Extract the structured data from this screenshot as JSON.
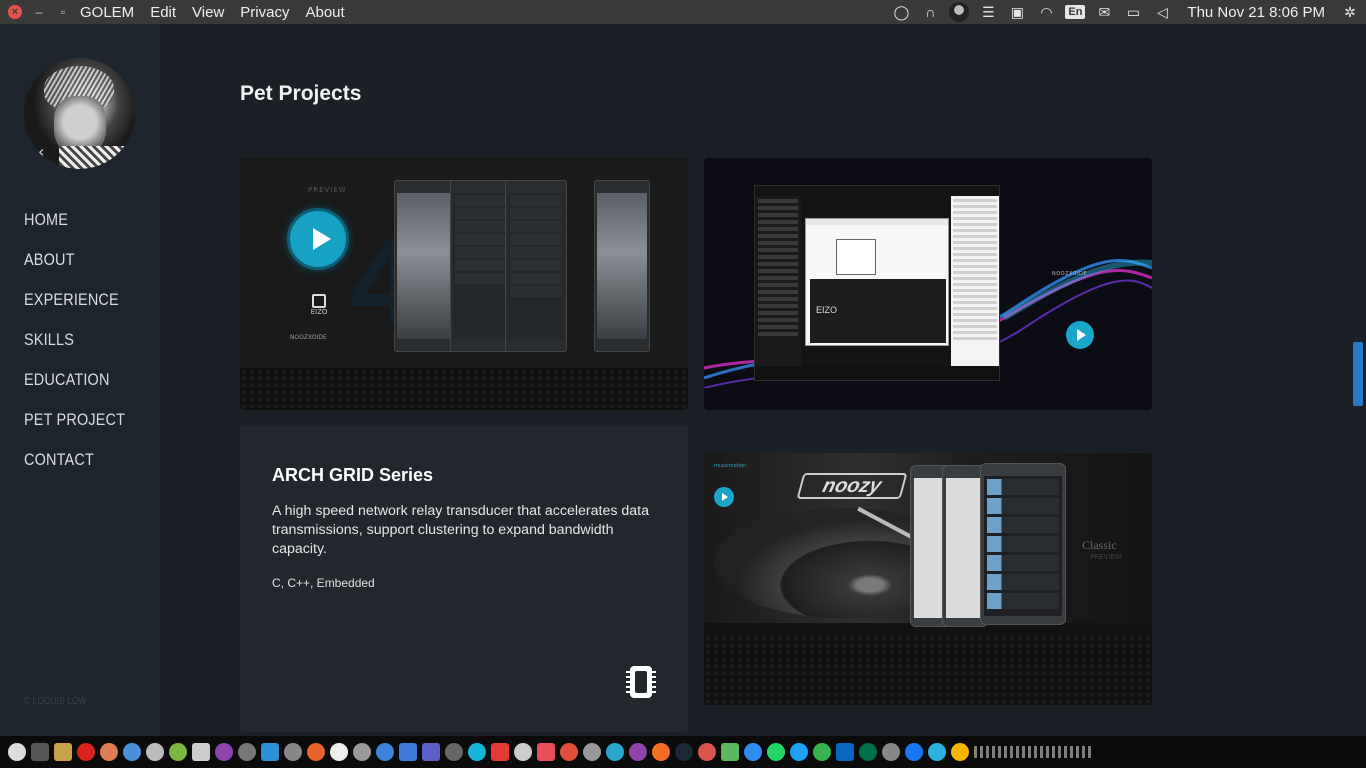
{
  "topbar": {
    "app_name": "GOLEM",
    "menu": [
      "Edit",
      "View",
      "Privacy",
      "About"
    ],
    "lang": "En",
    "clock": "Thu Nov 21  8:06 PM"
  },
  "sidebar": {
    "nav": [
      "HOME",
      "ABOUT",
      "EXPERIENCE",
      "SKILLS",
      "EDUCATION",
      "PET PROJECT",
      "CONTACT"
    ],
    "copyright": "© LOOUIS LOW"
  },
  "main": {
    "title": "Pet Projects",
    "card1": {
      "preview_label": "PREVIEW",
      "big_digits": "44",
      "eizo": "EIZO",
      "brand": "NOOZXOIDE"
    },
    "card2": {
      "brand": "NOOZXOIDE",
      "eizo": "EIZO"
    },
    "card3": {
      "title": "ARCH GRID Series",
      "description": "A high speed network relay transducer that accelerates data transmissions, support clustering to expand bandwidth capacity.",
      "tech": "C, C++, Embedded"
    },
    "card4": {
      "brand": "musicmotion",
      "logo": "noozy",
      "classic": "Classic",
      "classic_sub": "PREVIEW"
    }
  },
  "colors": {
    "accent": "#17a2c4",
    "scrollbar": "#2b79c6",
    "card_bg": "#22272e"
  }
}
